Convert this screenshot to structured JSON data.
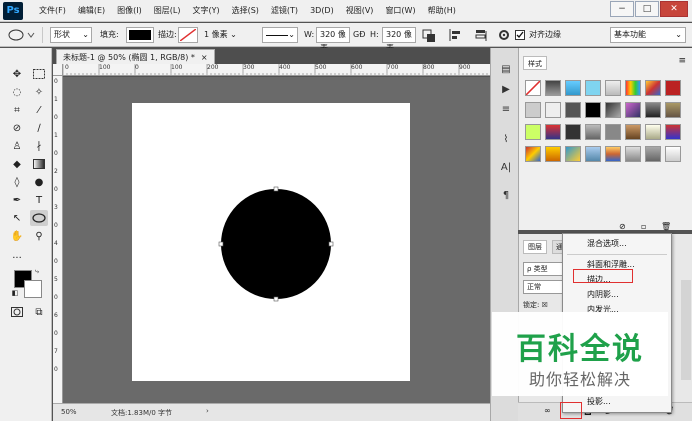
{
  "app": {
    "logo": "Ps"
  },
  "menu": [
    "文件(F)",
    "编辑(E)",
    "图像(I)",
    "图层(L)",
    "文字(Y)",
    "选择(S)",
    "滤镜(T)",
    "3D(D)",
    "视图(V)",
    "窗口(W)",
    "帮助(H)"
  ],
  "window_controls": {
    "minimize": "−",
    "maximize": "□",
    "close": "✕"
  },
  "options": {
    "shape_mode": "形状",
    "fill_label": "填充:",
    "stroke_label": "描边:",
    "stroke_width": "1 像素",
    "w_label": "W:",
    "w_value": "320 像素",
    "link": "GĐ",
    "h_label": "H:",
    "h_value": "320 像素",
    "align_edges": "对齐边缘",
    "workspace": "基本功能"
  },
  "document": {
    "tab_title": "未标题-1 @ 50% (椭圆 1, RGB/8) *",
    "tab_close": "×",
    "zoom": "50%",
    "doc_info": "文档:1.83M/0 字节",
    "status_arrow": "›"
  },
  "ruler_top": [
    "0",
    "100",
    "0",
    "100",
    "200",
    "300",
    "400",
    "500",
    "600",
    "700",
    "800",
    "900"
  ],
  "ruler_left": [
    "0",
    "1",
    "0",
    "1",
    "0",
    "2",
    "0",
    "3",
    "0",
    "4",
    "0",
    "5",
    "0",
    "6",
    "0",
    "7",
    "0"
  ],
  "styles_panel": {
    "tab": "样式"
  },
  "layers_panel": {
    "tab": "图层",
    "tab2": "通",
    "kind": "ρ 类型",
    "blend": "正常",
    "lock": "锁定: ☒"
  },
  "context_menu": {
    "items": [
      "混合选项...",
      "斜面和浮雕...",
      "描边...",
      "内阴影...",
      "内发光...",
      "投影..."
    ],
    "highlighted": "描边..."
  },
  "watermark": {
    "title": "百科全说",
    "subtitle": "助你轻松解决"
  },
  "colors": {
    "accent_green": "#1fa14a",
    "highlight_red": "#e03030",
    "ps_blue": "#31a8ff",
    "ps_dark": "#001e36"
  }
}
